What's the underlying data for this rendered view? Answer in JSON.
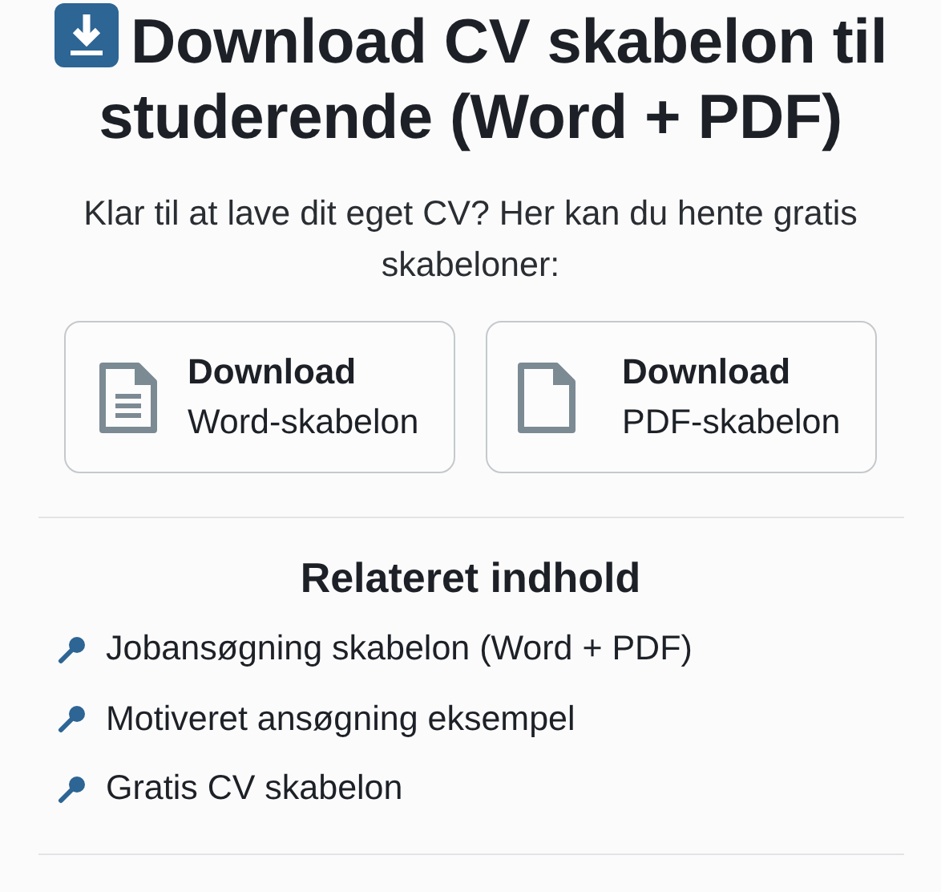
{
  "title": "Download CV skabelon til studerende (Word + PDF)",
  "intro": "Klar til at lave dit eget CV? Her kan du hente gratis skabeloner:",
  "downloads": [
    {
      "kind": "lined",
      "label": "Download",
      "sublabel": "Word-skabelon"
    },
    {
      "kind": "blank",
      "label": "Download",
      "sublabel": "PDF-skabelon"
    }
  ],
  "related": {
    "heading": "Relateret indhold",
    "items": [
      {
        "text": "Jobansøgning skabelon (Word + PDF)"
      },
      {
        "text": "Motiveret ansøgning eksempel"
      },
      {
        "text": "Gratis CV skabelon"
      }
    ]
  }
}
